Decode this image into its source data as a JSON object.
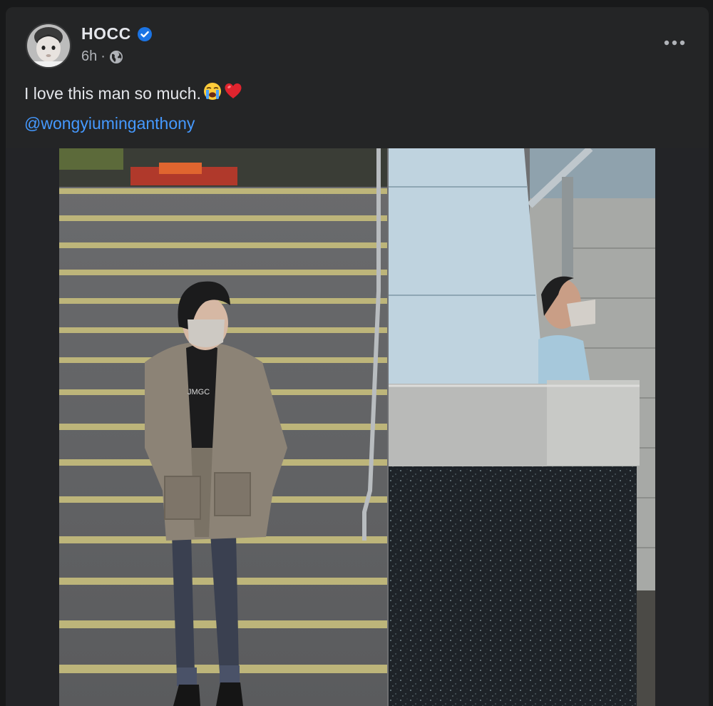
{
  "post": {
    "author": {
      "name": "HOCC",
      "verified": true,
      "avatar": "baby-portrait-avatar"
    },
    "meta": {
      "time": "6h",
      "separator": "·",
      "audience_icon": "globe-icon"
    },
    "text": "I love this man so much.",
    "text_emojis": [
      "loudly-crying-face",
      "red-heart"
    ],
    "mention": "@wongyiuminganthony",
    "menu_icon": "more-horizontal-icon",
    "photo": {
      "description_icon": "street-stairs-photo",
      "shirt_print": "JMGC"
    }
  },
  "colors": {
    "background": "#18191a",
    "card": "#242526",
    "text_primary": "#e4e6eb",
    "text_secondary": "#b0b3b8",
    "link": "#4599ff",
    "verified_badge": "#1b74e4"
  }
}
